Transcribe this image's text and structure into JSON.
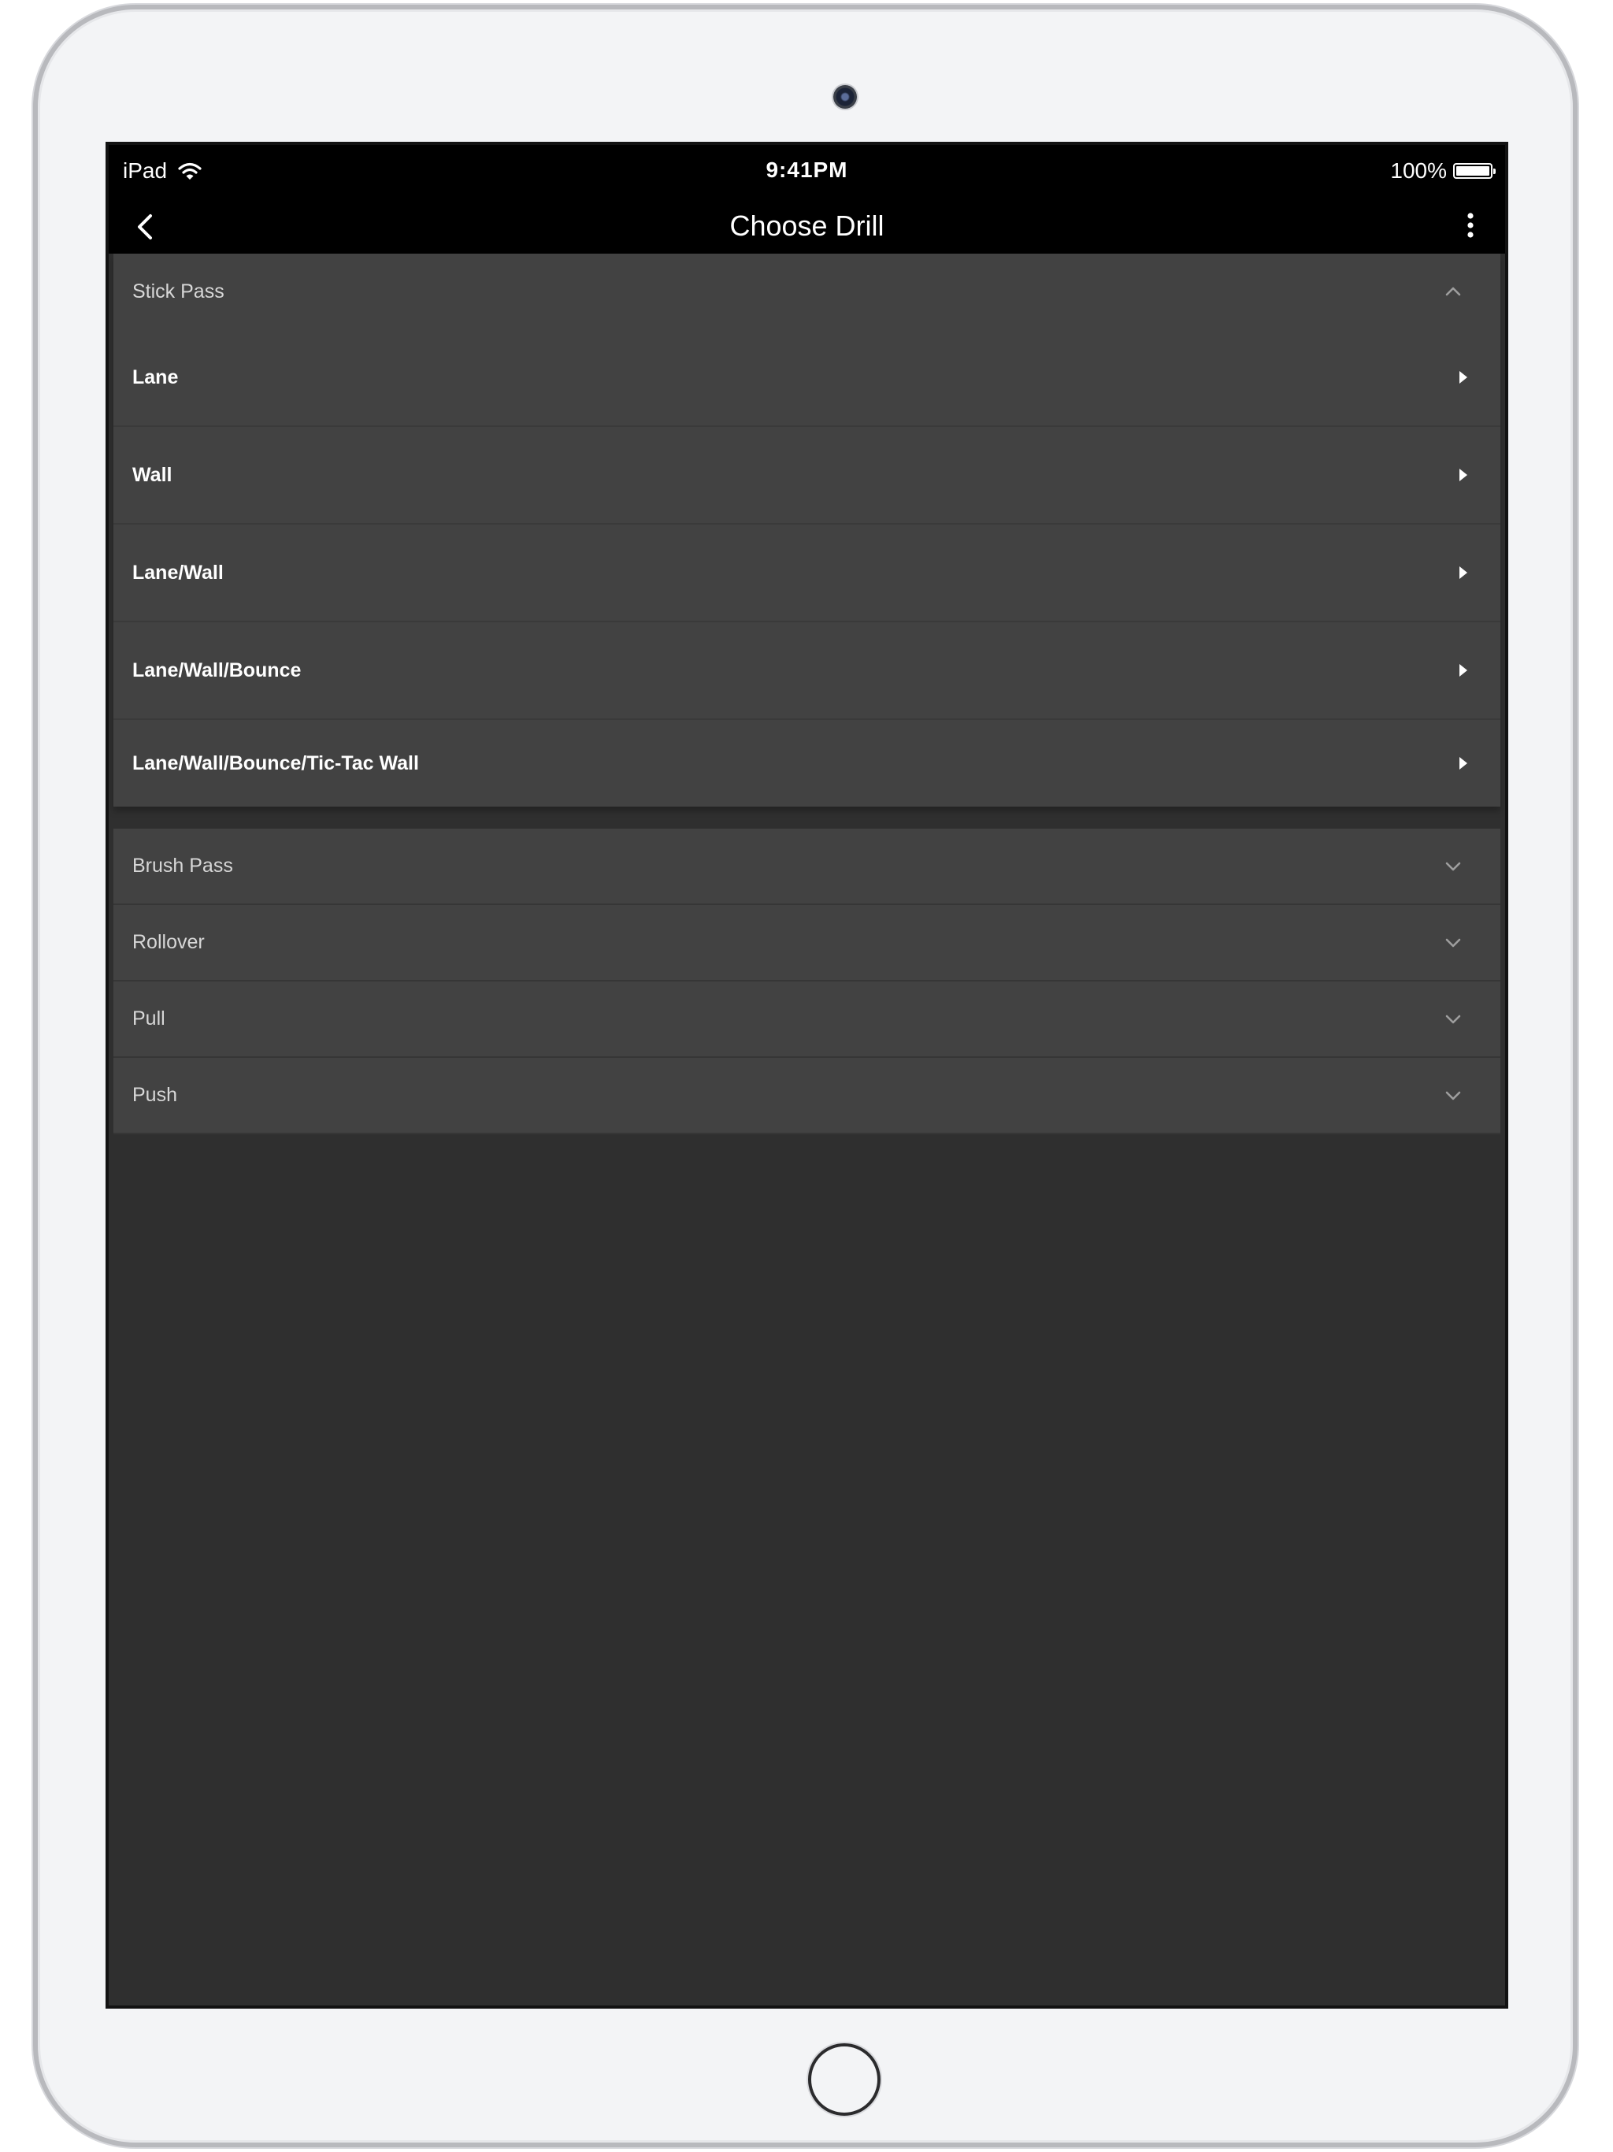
{
  "status_bar": {
    "device": "iPad",
    "time": "9:41PM",
    "battery": "100%",
    "battery_level": 1.0
  },
  "nav": {
    "title": "Choose Drill"
  },
  "icons": {
    "wifi": "wifi-icon",
    "battery": "battery-icon",
    "back": "chevron-left-icon",
    "more": "more-vertical-icon",
    "expand": "chevron-down-icon",
    "collapse": "chevron-up-icon",
    "drill": "caret-right-icon"
  },
  "sections": [
    {
      "label": "Stick Pass",
      "expanded": true,
      "items": [
        {
          "label": "Lane"
        },
        {
          "label": "Wall"
        },
        {
          "label": "Lane/Wall"
        },
        {
          "label": "Lane/Wall/Bounce"
        },
        {
          "label": "Lane/Wall/Bounce/Tic-Tac Wall"
        }
      ]
    },
    {
      "label": "Brush Pass",
      "expanded": false
    },
    {
      "label": "Rollover",
      "expanded": false
    },
    {
      "label": "Pull",
      "expanded": false
    },
    {
      "label": "Push",
      "expanded": false
    }
  ],
  "colors": {
    "screen_bg": "#2f2f2f",
    "row_bg": "#424242",
    "bar_bg": "#000000"
  }
}
